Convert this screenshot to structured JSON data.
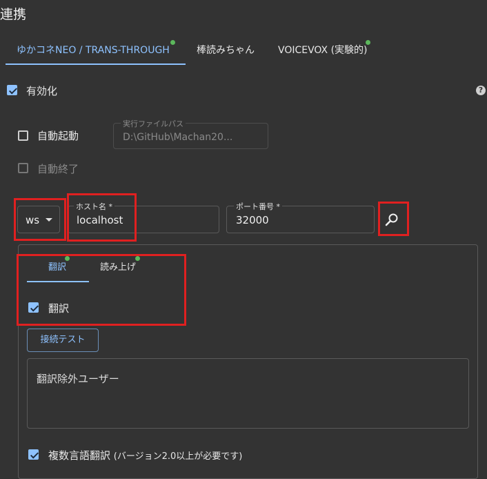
{
  "section_title": "連携",
  "tabs": [
    {
      "label": "ゆかコネNEO / TRANS-THROUGH",
      "active": true,
      "indicator": true
    },
    {
      "label": "棒読みちゃん",
      "active": false,
      "indicator": false
    },
    {
      "label": "VOICEVOX (実験的)",
      "active": false,
      "indicator": true
    }
  ],
  "enabled": {
    "label": "有効化",
    "checked": true
  },
  "help_icon": "?",
  "auto_start": {
    "label": "自動起動",
    "checked": false
  },
  "auto_stop": {
    "label": "自動終了",
    "checked": false,
    "disabled": true
  },
  "exe_path": {
    "label": "実行ファイルパス",
    "value": "D:\\GitHub\\Machan20..."
  },
  "protocol": {
    "value": "ws",
    "icon": "caret-down-icon"
  },
  "host": {
    "label": "ホスト名 *",
    "value": "localhost"
  },
  "port": {
    "label": "ポート番号 *",
    "value": "32000"
  },
  "search_icon": "magnify-icon",
  "subtabs": [
    {
      "label": "翻訳",
      "active": true,
      "indicator": true
    },
    {
      "label": "読み上げ",
      "active": false,
      "indicator": true
    }
  ],
  "translate": {
    "label": "翻訳",
    "checked": true
  },
  "test_button": "接続テスト",
  "exclude_users": {
    "placeholder": "翻訳除外ユーザー"
  },
  "multi_lang": {
    "label": "複数言語翻訳",
    "note": "(バージョン2.0以上が必要です)",
    "checked": true
  },
  "colors": {
    "accent": "#8ec2ff",
    "indicator": "#5cb85c",
    "highlight": "#e02020",
    "background": "#333333"
  }
}
